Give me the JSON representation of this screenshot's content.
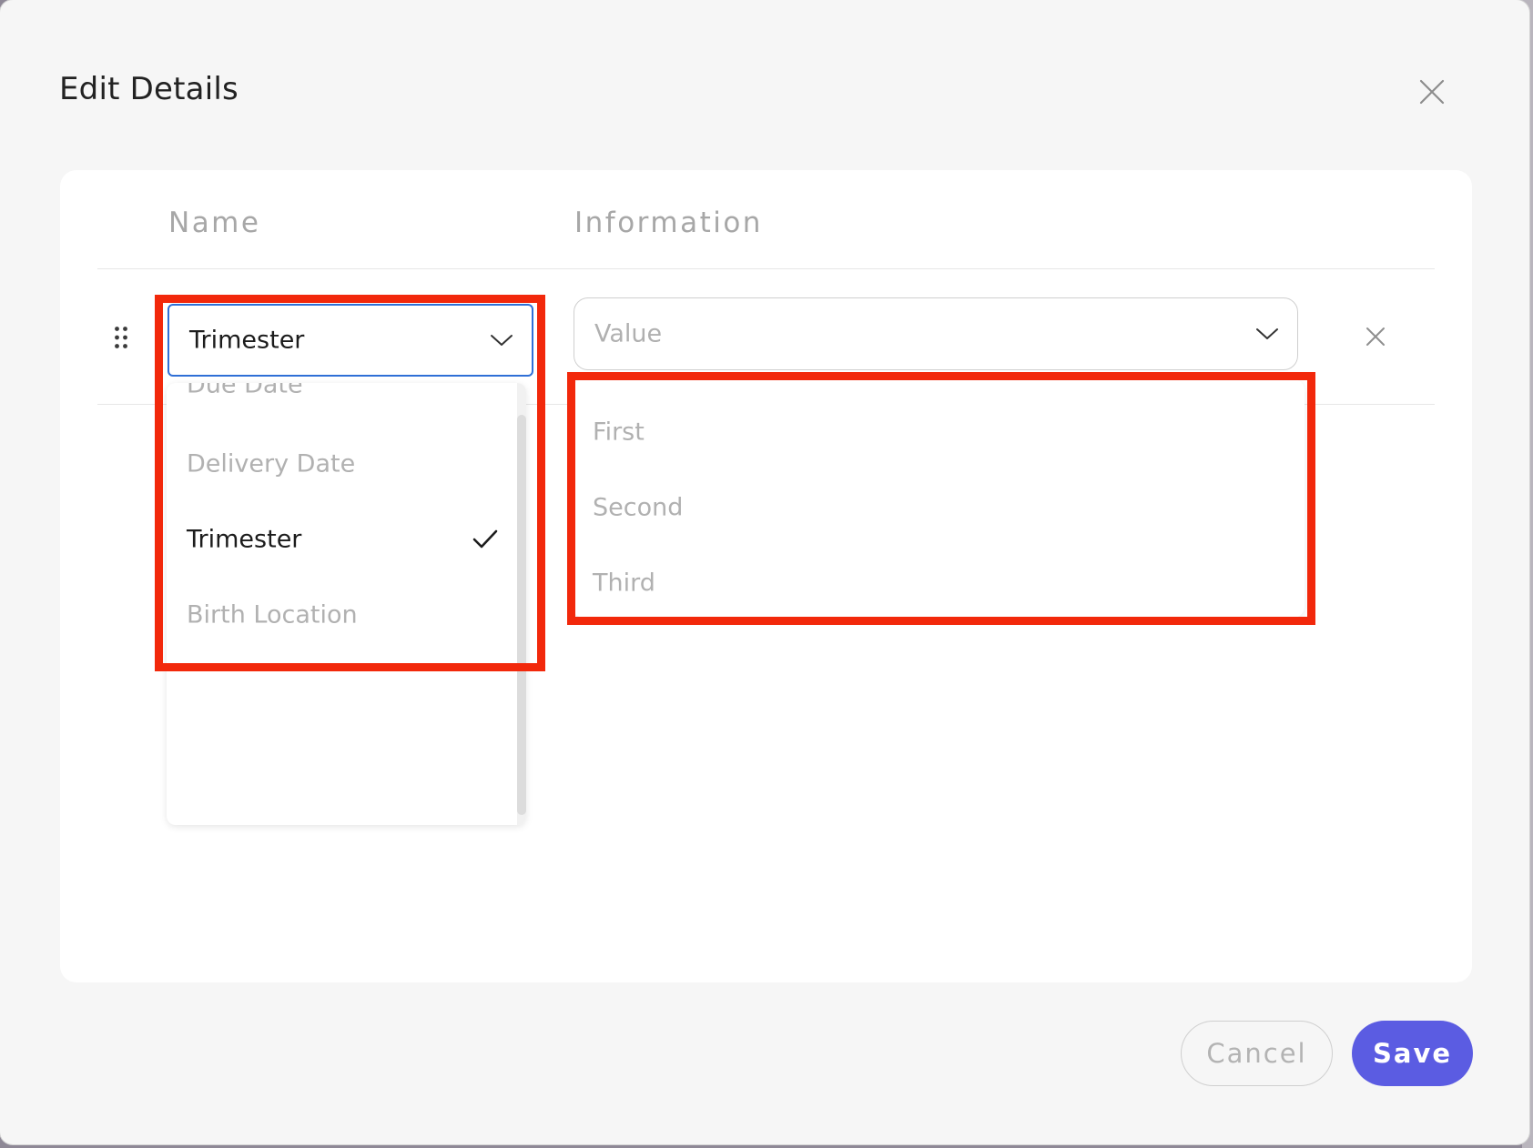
{
  "modal": {
    "title": "Edit Details"
  },
  "table": {
    "headers": {
      "name": "Name",
      "information": "Information"
    },
    "row": {
      "name_value": "Trimester",
      "info_placeholder": "Value"
    }
  },
  "name_dropdown": {
    "options": [
      {
        "label": "Due Date",
        "selected": false
      },
      {
        "label": "Delivery Date",
        "selected": false
      },
      {
        "label": "Trimester",
        "selected": true
      },
      {
        "label": "Birth Location",
        "selected": false
      }
    ]
  },
  "info_dropdown": {
    "options": [
      {
        "label": "First"
      },
      {
        "label": "Second"
      },
      {
        "label": "Third"
      }
    ]
  },
  "footer": {
    "cancel_label": "Cancel",
    "save_label": "Save"
  },
  "colors": {
    "accent": "#5b5ce2",
    "focus_border": "#2f6fd6",
    "annotation": "#f2280b"
  },
  "icons": {
    "close": "close-icon",
    "drag": "drag-handle-icon",
    "chevron": "chevron-down-icon",
    "check": "check-icon",
    "remove": "remove-row-icon"
  }
}
